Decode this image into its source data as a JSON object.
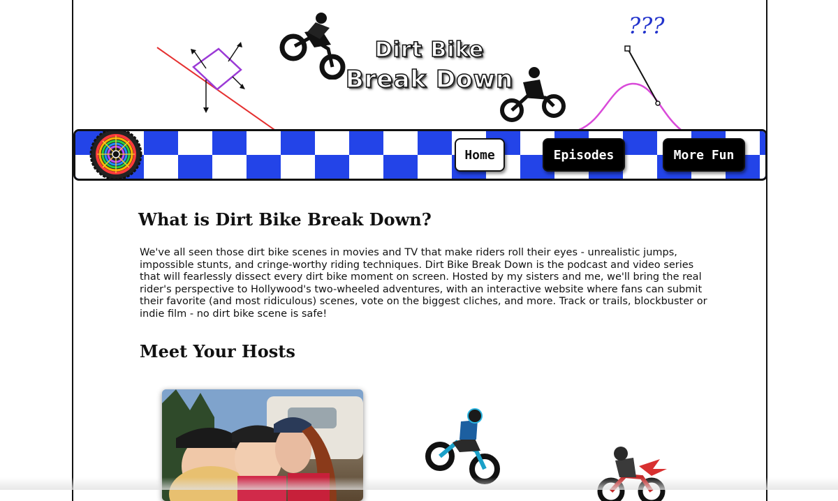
{
  "header": {
    "title_line1": "Dirt Bike",
    "title_line2": "Break Down",
    "question_marks": "???",
    "art_icons": [
      "incline-diagram-icon",
      "dirt-bike-rider-icon",
      "sine-curve-icon"
    ]
  },
  "nav": {
    "logo_icon": "rainbow-wheel-icon",
    "items": [
      {
        "label": "Home",
        "active": true
      },
      {
        "label": "Episodes",
        "active": false
      },
      {
        "label": "More Fun",
        "active": false
      }
    ],
    "colors": {
      "check_blue": "#2344e8",
      "button_black": "#000000",
      "button_white": "#ffffff"
    }
  },
  "main": {
    "what_heading": "What is Dirt Bike Break Down?",
    "intro_text": "We've all seen those dirt bike scenes in movies and TV that make riders roll their eyes - unrealistic jumps, impossible stunts, and cringe-worthy riding techniques. Dirt Bike Break Down is the podcast and video series that will fearlessly dissect every dirt bike moment on screen. Hosted by my sisters and me, we'll bring the real rider's perspective to Hollywood's two-wheeled adventures, with an interactive website where fans can submit their favorite (and most ridiculous) scenes, vote on the biggest cliches, and more. Track or trails, blockbuster or indie film - no dirt bike scene is safe!",
    "hosts_heading": "Meet Your Hosts",
    "hosts_icons": [
      "hosts-photo",
      "blue-dirt-bike-icon",
      "red-dirt-bike-icon"
    ]
  }
}
